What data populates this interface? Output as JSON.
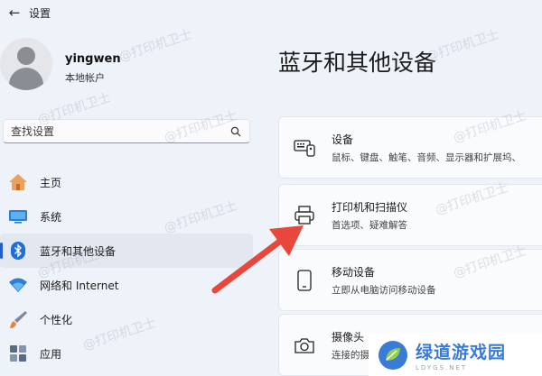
{
  "window": {
    "title": "设置"
  },
  "profile": {
    "name": "yingwen",
    "account_type": "本地帐户"
  },
  "search": {
    "placeholder": "查找设置"
  },
  "nav": {
    "items": [
      {
        "label": "主页",
        "icon": "home-icon"
      },
      {
        "label": "系统",
        "icon": "system-icon"
      },
      {
        "label": "蓝牙和其他设备",
        "icon": "bluetooth-icon",
        "active": true
      },
      {
        "label": "网络和 Internet",
        "icon": "wifi-icon"
      },
      {
        "label": "个性化",
        "icon": "brush-icon"
      },
      {
        "label": "应用",
        "icon": "apps-icon"
      }
    ]
  },
  "main": {
    "title": "蓝牙和其他设备",
    "cards": [
      {
        "title": "设备",
        "desc": "鼠标、键盘、触笔、音频、显示器和扩展坞、",
        "icon": "devices-icon"
      },
      {
        "title": "打印机和扫描仪",
        "desc": "首选项、疑难解答",
        "icon": "printer-icon"
      },
      {
        "title": "移动设备",
        "desc": "立即从电脑访问移动设备",
        "icon": "phone-icon"
      },
      {
        "title": "摄像头",
        "desc": "连接的摄像头、默认设置",
        "icon": "camera-icon"
      }
    ]
  },
  "watermark": {
    "text": "@打印机卫士"
  },
  "site_logo": {
    "name": "绿道游戏园",
    "url": "LDYGS.NET"
  },
  "colors": {
    "accent": "#1f5fc7",
    "arrow": "#e8473b",
    "background": "#eef2f9"
  }
}
